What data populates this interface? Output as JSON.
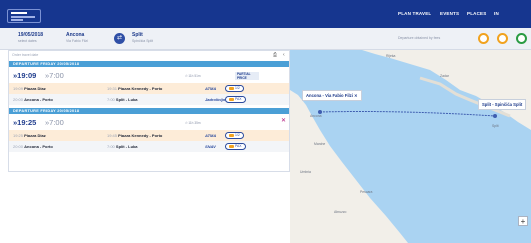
{
  "header": {
    "nav": [
      "PLAN TRAVEL",
      "EVENTS",
      "PLACES",
      "IN"
    ]
  },
  "search": {
    "date": "19/05/2018",
    "date_sub": "select dates",
    "from": "Ancona",
    "from_sub": "Via Fabio Filzi",
    "to": "Split",
    "to_sub": "Spinčića Split",
    "right_text": "Departure obtained by fees"
  },
  "results": {
    "filter_placeholder": "Order travel date",
    "days": [
      {
        "header": "DEPARTURE FRIDAY 20/05/2018",
        "dep_time": "19:09",
        "arr_time": "7:00",
        "duration": "11h 51m",
        "badge": "PARTIAL PRICE",
        "legs": [
          {
            "dep_time": "19:09",
            "dep": "Piazza Diaz",
            "arr_time": "19:31",
            "arr": "Piazza Kennedy - Porto",
            "op": "ATMA",
            "pill": "1/2",
            "style": "orange"
          },
          {
            "dep_time": "20:00",
            "dep": "Ancona - Porto",
            "arr_time": "7:00",
            "arr": "Split - Luka",
            "op": "Jadrolinija",
            "pill": "PAX",
            "style": "gray"
          }
        ]
      },
      {
        "header": "DEPARTURE FRIDAY 20/05/2018",
        "dep_time": "19:25",
        "arr_time": "7:00",
        "duration": "11h 35m",
        "badge": "",
        "legs": [
          {
            "dep_time": "19:25",
            "dep": "Piazza Diaz",
            "arr_time": "19:45",
            "arr": "Piazza Kennedy - Porto",
            "op": "ATMA",
            "pill": "1/2",
            "style": "orange"
          },
          {
            "dep_time": "20:00",
            "dep": "Ancona - Porto",
            "arr_time": "7:00",
            "arr": "Split - Luka",
            "op": "SNAV",
            "pill": "PAX",
            "style": "gray"
          }
        ]
      }
    ]
  },
  "map": {
    "popup_origin": "Ancona - Via Fabio Filzi",
    "popup_dest": "Split - Spinčića Split",
    "labels": [
      "Ancona",
      "Marche",
      "Umbria",
      "Pescara",
      "Abruzzo",
      "Split",
      "Zadar",
      "Rijeka"
    ],
    "colors": {
      "sea": "#aad3f2",
      "land": "#f2efe9",
      "route": "#3f5eb0"
    }
  }
}
